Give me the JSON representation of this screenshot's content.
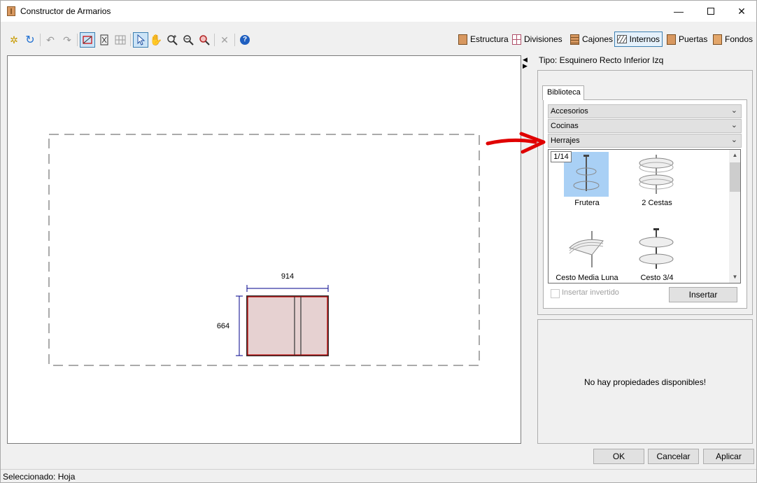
{
  "window": {
    "title": "Constructor de Armarios"
  },
  "toolbar": {
    "tools": [
      "new-icon",
      "refresh-icon",
      "undo-icon",
      "redo-icon",
      "plan-view-icon",
      "section-view-icon",
      "grid-icon",
      "pointer-icon",
      "pan-icon",
      "zoom-extents-icon",
      "zoom-out-icon",
      "zoom-icon",
      "delete-icon",
      "help-icon"
    ],
    "categories": [
      {
        "label": "Estructura",
        "icon": "estructura-icon"
      },
      {
        "label": "Divisiones",
        "icon": "divisiones-icon"
      },
      {
        "label": "Cajones",
        "icon": "cajones-icon"
      },
      {
        "label": "Internos",
        "icon": "internos-icon",
        "active": true
      },
      {
        "label": "Puertas",
        "icon": "puertas-icon"
      },
      {
        "label": "Fondos",
        "icon": "fondos-icon"
      }
    ]
  },
  "drawing": {
    "width_dim": "914",
    "depth_dim": "664"
  },
  "panel": {
    "tipo": "Tipo: Esquinero Recto Inferior Izq",
    "library_tab": "Biblioteca",
    "groups": [
      "Accesorios",
      "Cocinas",
      "Herrajes"
    ],
    "pager": "1/14",
    "items": [
      {
        "label": "Frutera",
        "selected": true
      },
      {
        "label": "2 Cestas",
        "selected": false
      },
      {
        "label": "Cesto Media Luna",
        "selected": false
      },
      {
        "label": "Cesto 3/4",
        "selected": false
      }
    ],
    "invert_label": "Insertar invertido",
    "insert_label": "Insertar",
    "no_props": "No hay propiedades disponibles!"
  },
  "dialog_buttons": {
    "ok": "OK",
    "cancel": "Cancelar",
    "apply": "Aplicar"
  },
  "status": {
    "text": "Seleccionado: Hoja"
  },
  "colors": {
    "accent": "#3c7fb1",
    "selection": "#a9d0f5",
    "cabinet_fill": "#e6d1d1",
    "cabinet_edge": "#c00000",
    "dimension": "#00008b",
    "annotation_arrow": "#e00000"
  }
}
